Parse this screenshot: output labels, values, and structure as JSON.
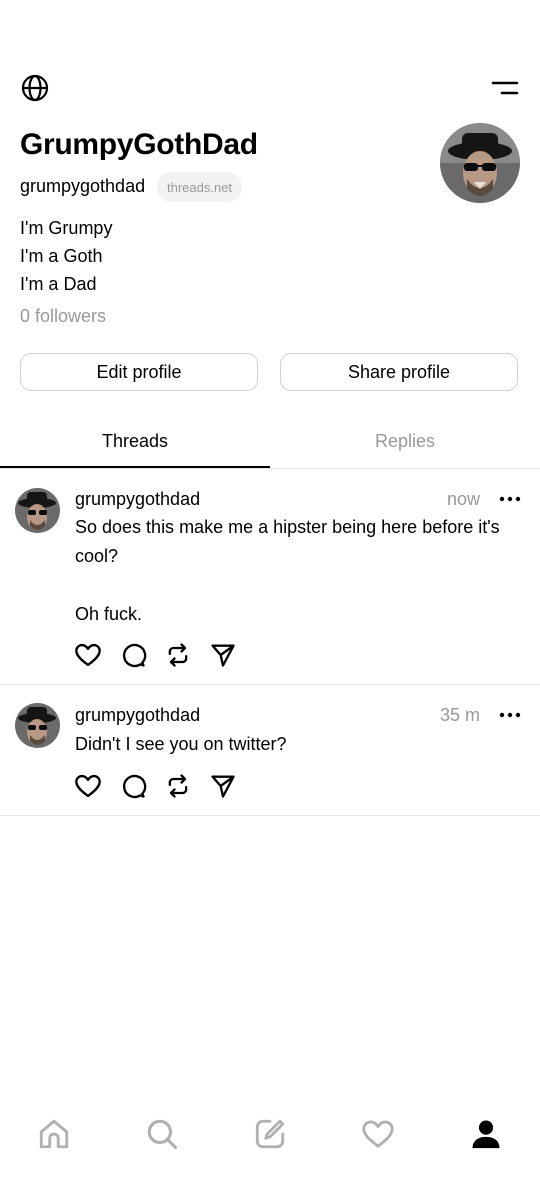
{
  "profile": {
    "display_name": "GrumpyGothDad",
    "username": "grumpygothdad",
    "domain_chip": "threads.net",
    "bio": [
      "I'm Grumpy",
      "I'm a Goth",
      "I'm a Dad"
    ],
    "followers": "0 followers",
    "avatar": "avatar-photo"
  },
  "header": {
    "left_icon": "globe-icon",
    "right_icon": "menu-icon"
  },
  "buttons": {
    "edit": "Edit profile",
    "share": "Share profile"
  },
  "tabs": [
    {
      "label": "Threads",
      "active": true
    },
    {
      "label": "Replies",
      "active": false
    }
  ],
  "posts": [
    {
      "username": "grumpygothdad",
      "time": "now",
      "text": "So does this make me a hipster being here before it's cool?\n\nOh fuck."
    },
    {
      "username": "grumpygothdad",
      "time": "35 m",
      "text": "Didn't I see you on twitter?"
    }
  ],
  "post_actions": [
    "heart-icon",
    "comment-icon",
    "repost-icon",
    "send-icon"
  ],
  "bottom_nav": [
    "home-icon",
    "search-icon",
    "compose-icon",
    "activity-icon",
    "profile-icon"
  ],
  "colors": {
    "text": "#000000",
    "muted": "#999999",
    "divider": "#e6e6e6",
    "chip_bg": "#f2f2f2"
  }
}
